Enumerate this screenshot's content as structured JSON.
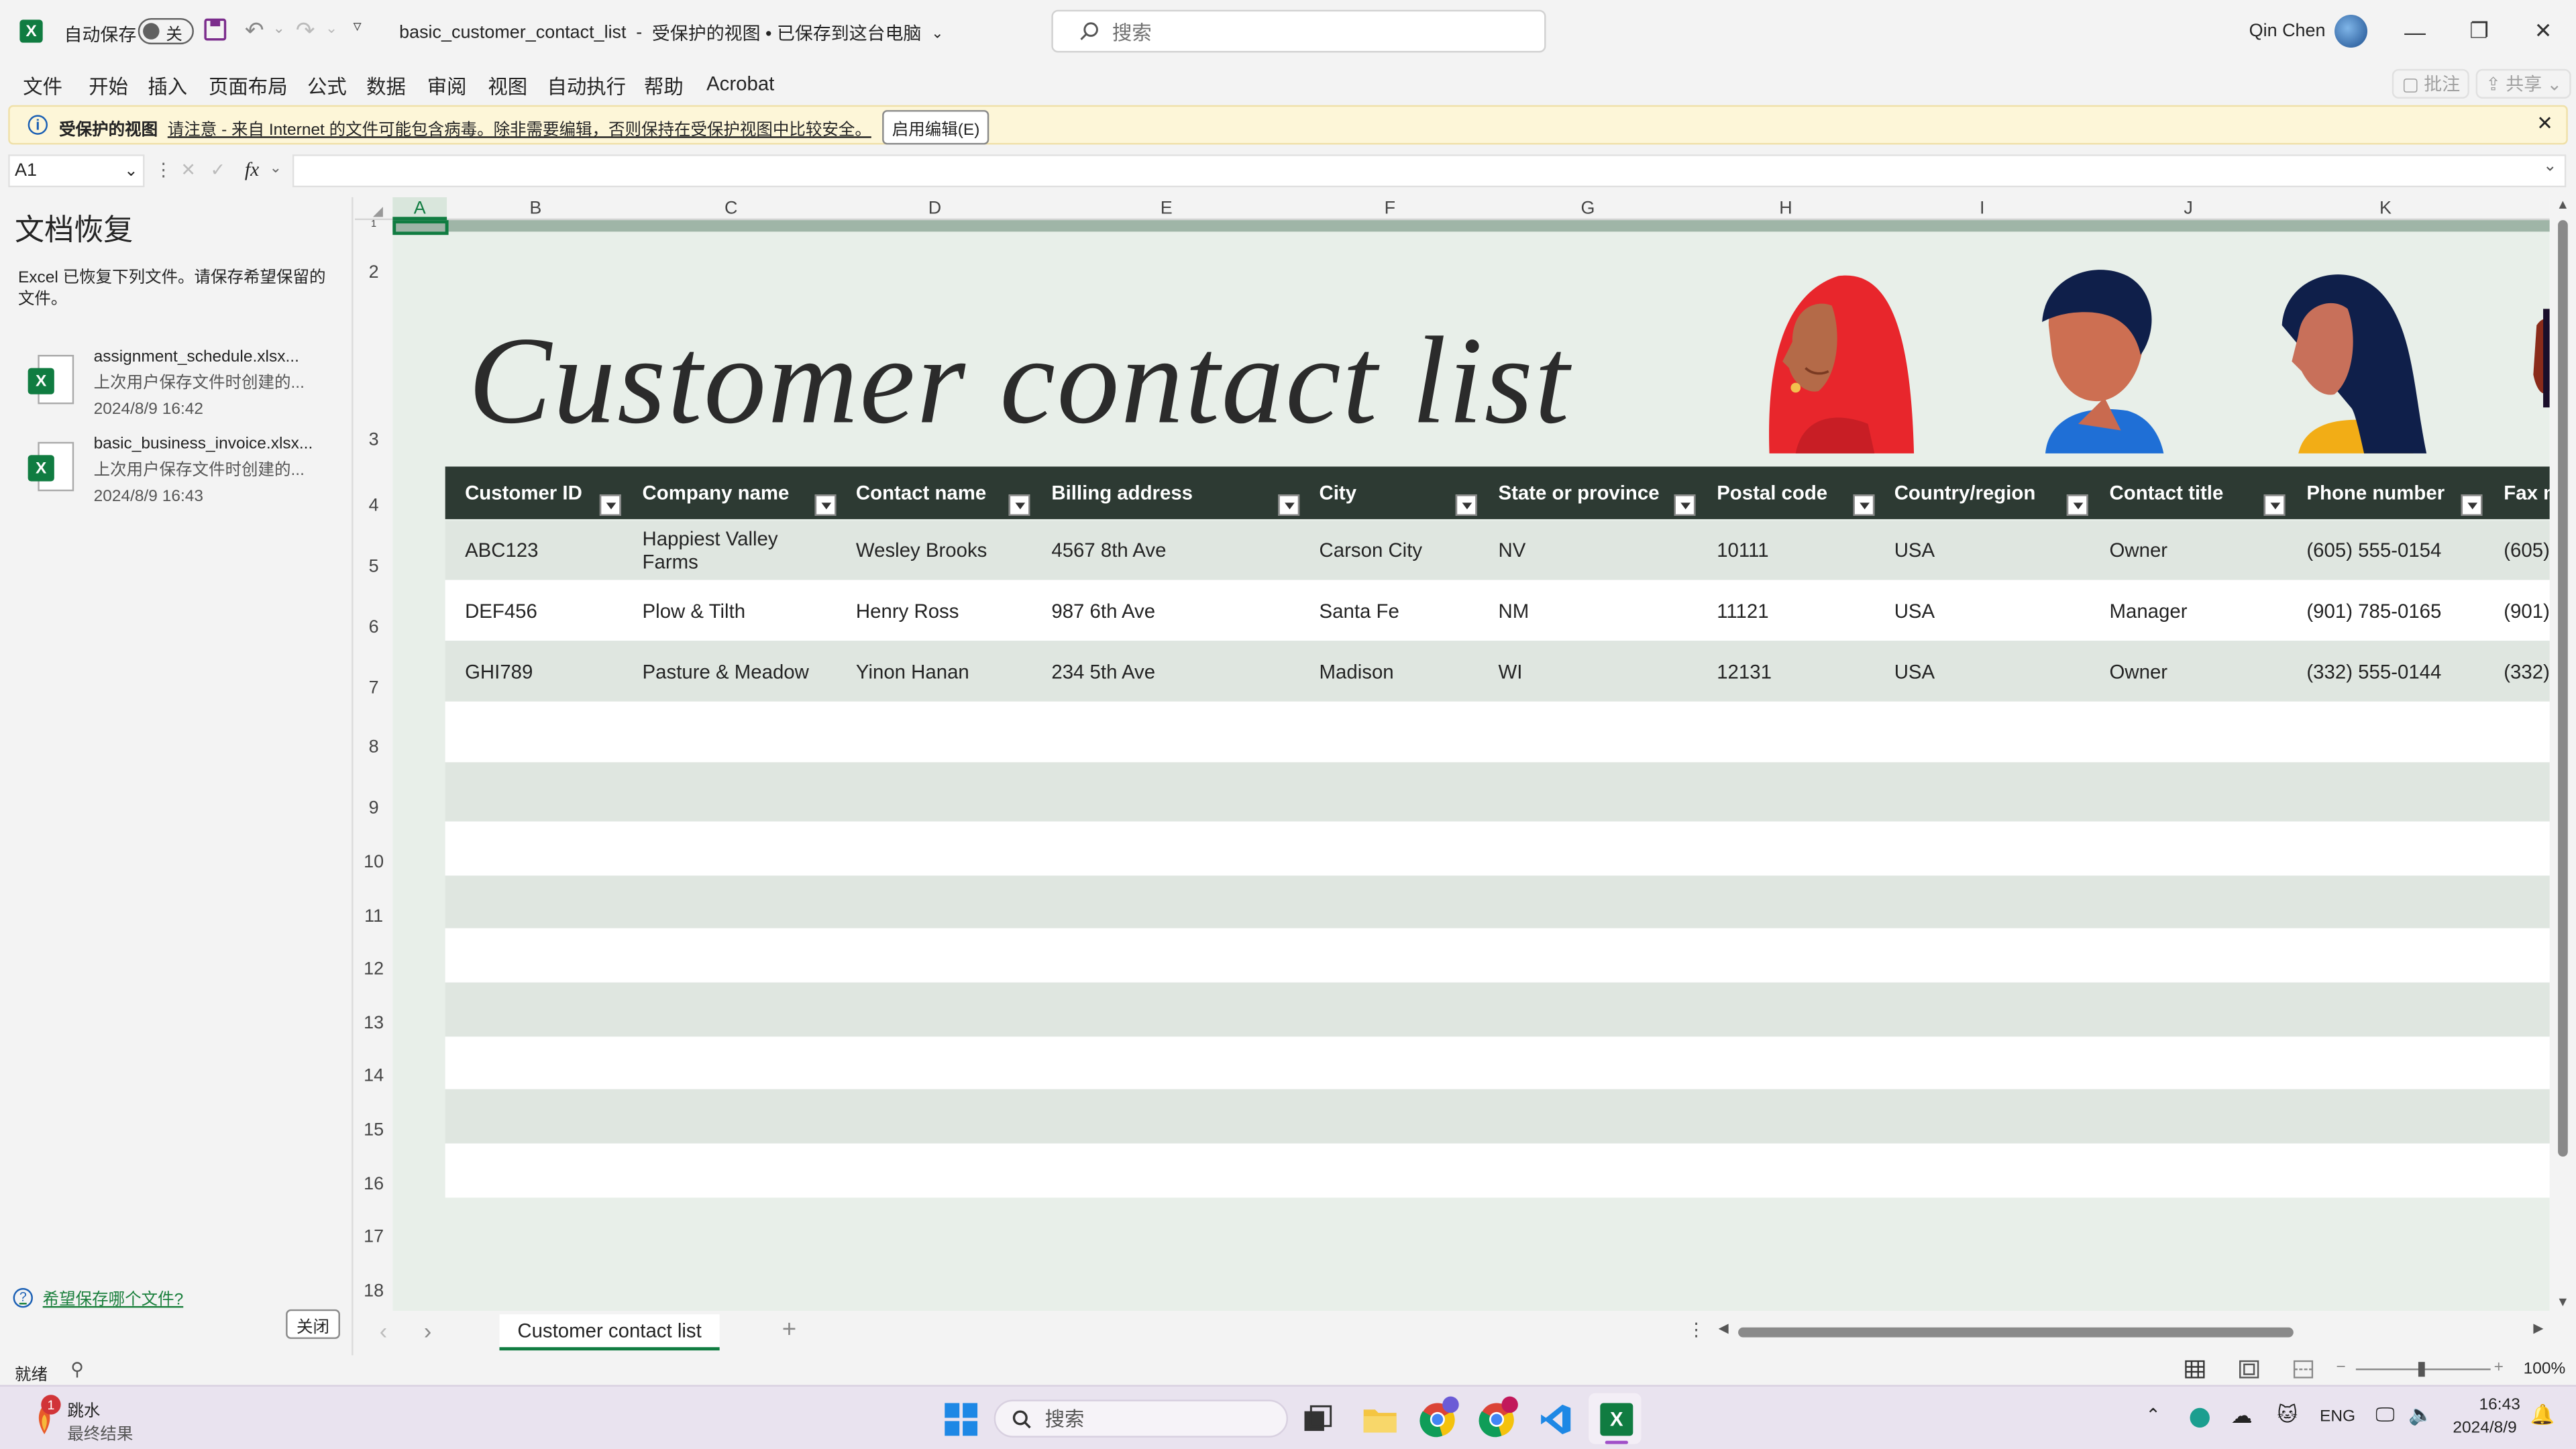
{
  "titlebar": {
    "autosave_label": "自动保存",
    "autosave_state": "关",
    "filename": "basic_customer_contact_list",
    "separator": "-",
    "status": "受保护的视图 • 已保存到这台电脑",
    "search_placeholder": "搜索",
    "user_name": "Qin Chen"
  },
  "menu": {
    "items": [
      "文件",
      "开始",
      "插入",
      "页面布局",
      "公式",
      "数据",
      "审阅",
      "视图",
      "自动执行",
      "帮助",
      "Acrobat"
    ],
    "comments_label": "批注",
    "share_label": "共享"
  },
  "protected_bar": {
    "title": "受保护的视图",
    "message": "请注意 - 来自 Internet 的文件可能包含病毒。除非需要编辑，否则保持在受保护视图中比较安全。",
    "enable_button": "启用编辑(E)"
  },
  "formula_bar": {
    "name_box": "A1",
    "fx": "fx",
    "value": ""
  },
  "recovery": {
    "title": "文档恢复",
    "description": "Excel 已恢复下列文件。请保存希望保留的文件。",
    "files": [
      {
        "name": "assignment_schedule.xlsx...",
        "note": "上次用户保存文件时创建的...",
        "time": "2024/8/9 16:42"
      },
      {
        "name": "basic_business_invoice.xlsx...",
        "note": "上次用户保存文件时创建的...",
        "time": "2024/8/9 16:43"
      }
    ],
    "help_link": "希望保存哪个文件?",
    "close_button": "关闭"
  },
  "grid": {
    "columns": [
      "A",
      "B",
      "C",
      "D",
      "E",
      "F",
      "G",
      "H",
      "I",
      "J",
      "K"
    ],
    "rows": [
      "1",
      "2",
      "3",
      "4",
      "5",
      "6",
      "7",
      "8",
      "9",
      "10",
      "11",
      "12",
      "13",
      "14",
      "15",
      "16",
      "17",
      "18"
    ]
  },
  "sheet": {
    "title": "Customer contact list",
    "headers": [
      "Customer ID",
      "Company name",
      "Contact name",
      "Billing address",
      "City",
      "State or province",
      "Postal code",
      "Country/region",
      "Contact title",
      "Phone number",
      "Fax n"
    ],
    "rows": [
      [
        "ABC123",
        "Happiest Valley Farms",
        "Wesley Brooks",
        "4567 8th Ave",
        "Carson City",
        "NV",
        "10111",
        "USA",
        "Owner",
        "(605) 555-0154",
        "(605)"
      ],
      [
        "DEF456",
        "Plow & Tilth",
        "Henry Ross",
        "987 6th Ave",
        "Santa Fe",
        "NM",
        "11121",
        "USA",
        "Manager",
        "(901) 785-0165",
        "(901)"
      ],
      [
        "GHI789",
        "Pasture & Meadow",
        "Yinon Hanan",
        "234 5th Ave",
        "Madison",
        "WI",
        "12131",
        "USA",
        "Owner",
        "(332) 555-0144",
        "(332)"
      ]
    ],
    "colors": {
      "header_bg": "#2d3a33",
      "band_bg": "#dfe6e0",
      "sheet_bg": "#e8efe9"
    }
  },
  "tabs": {
    "active": "Customer contact list",
    "add": "+"
  },
  "statusbar": {
    "ready": "就绪",
    "zoom": "100%"
  },
  "taskbar": {
    "weather_title": "跳水",
    "weather_sub": "最终结果",
    "weather_badge": "1",
    "search_placeholder": "搜索",
    "lang": "ENG",
    "time": "16:43",
    "date": "2024/8/9"
  }
}
